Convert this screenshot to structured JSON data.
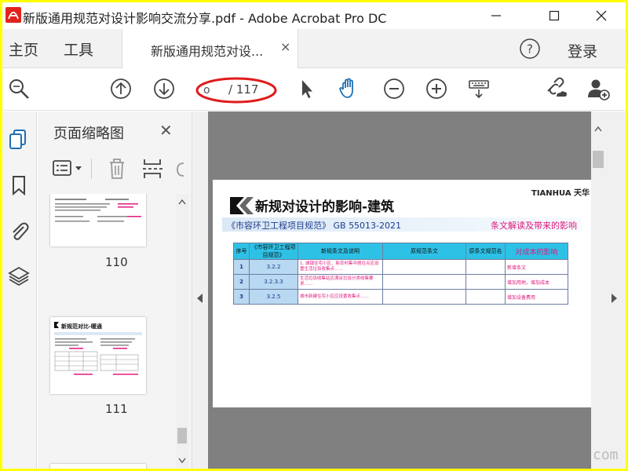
{
  "window": {
    "title": "新版通用规范对设计影响交流分享.pdf - Adobe Acrobat Pro DC",
    "controls": [
      "minimize",
      "maximize",
      "close"
    ]
  },
  "menubar": {
    "home": "主页",
    "tools": "工具",
    "doc_tab": "新版通用规范对设...",
    "doc_tab_close": "×",
    "help": "?",
    "login": "登录"
  },
  "toolbar": {
    "current_page": "o",
    "total_pages": "/ 117",
    "icons": [
      "zoom-search-icon",
      "page-up-icon",
      "page-down-icon",
      "select-cursor-icon",
      "hand-tool-icon",
      "zoom-out-icon",
      "zoom-in-icon",
      "keyboard-scroll-icon",
      "link-cloud-icon",
      "add-user-icon"
    ]
  },
  "left_rail": {
    "icons": [
      "page-thumbnails-icon",
      "bookmark-icon",
      "attachment-icon",
      "layers-icon"
    ]
  },
  "thumb_panel": {
    "title": "页面缩略图",
    "close": "✕",
    "pages": [
      {
        "number": "110"
      },
      {
        "number": "111",
        "heading": "新规范对比-暖通"
      }
    ]
  },
  "pdf": {
    "brand": "TIANHUA 天华",
    "title": "新规对设计的影响-建筑",
    "standard": "《市容环卫工程项目规范》 GB 55013-2021",
    "subtitle": "条文解读及带来的影响",
    "table": {
      "headers": [
        "序号",
        "《市容环卫工程项目规范》",
        "新规条文及说明",
        "原规范条文",
        "原条文规范名",
        "对成本的影响"
      ],
      "rows": [
        {
          "idx": "1",
          "code": "3.2.2",
          "text": "1. 城镇住宅小区、新农村集中居住点应设置生活垃圾收集点……",
          "impact": "新增条文"
        },
        {
          "idx": "2",
          "code": "3.2.3.3",
          "text": "生活垃圾收集站应满足垃圾分类收集要求……",
          "impact": "增加用地，增加成本"
        },
        {
          "idx": "3",
          "code": "3.2.5",
          "text": "城市新建住宅小区应设置收集点……",
          "impact": "增加设备费用"
        }
      ]
    }
  },
  "watermark": "com"
}
